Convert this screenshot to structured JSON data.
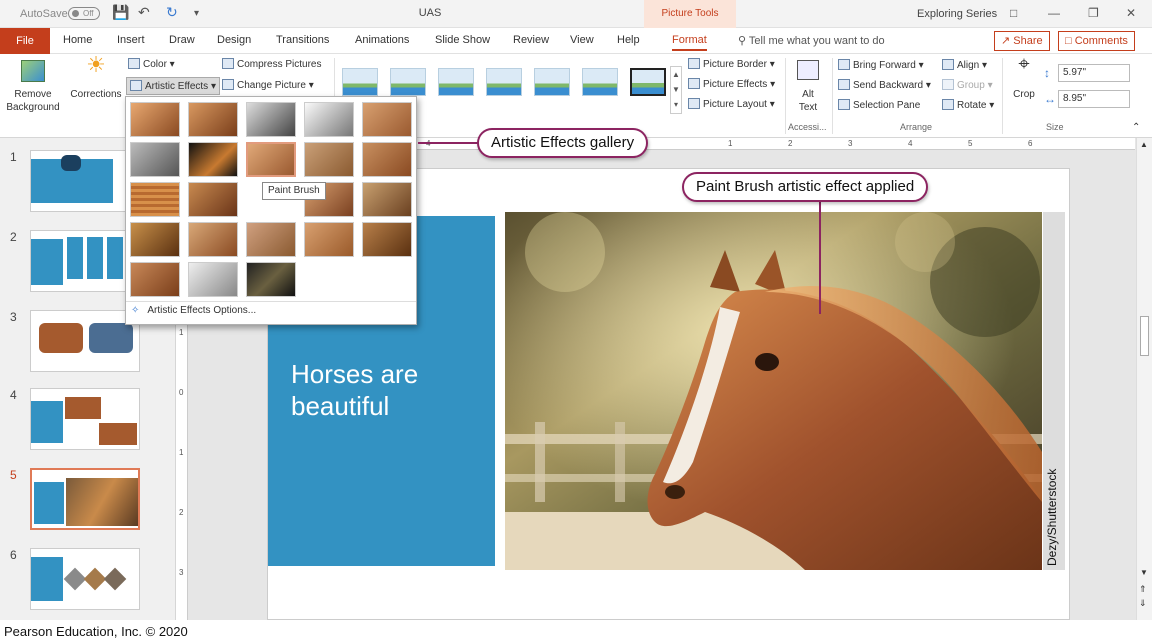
{
  "titlebar": {
    "autosave": "AutoSave",
    "autosave_state": "Off",
    "doc_title": "UAS",
    "context_tab": "Picture Tools",
    "series": "Exploring Series"
  },
  "tabs": {
    "file": "File",
    "items": [
      "Home",
      "Insert",
      "Draw",
      "Design",
      "Transitions",
      "Animations",
      "Slide Show",
      "Review",
      "View",
      "Help",
      "Format"
    ],
    "tell_me": "Tell me what you want to do",
    "share": "Share",
    "comments": "Comments"
  },
  "ribbon": {
    "remove_background": "Remove Background",
    "corrections": "Corrections",
    "color": "Color",
    "artistic_effects": "Artistic Effects",
    "compress": "Compress Pictures",
    "change": "Change Picture",
    "picture_border": "Picture Border",
    "picture_effects": "Picture Effects",
    "picture_layout": "Picture Layout",
    "alt_text": "Alt Text",
    "accessibility": "Accessi...",
    "bring_forward": "Bring Forward",
    "send_backward": "Send Backward",
    "selection_pane": "Selection Pane",
    "align": "Align",
    "group": "Group",
    "rotate": "Rotate",
    "arrange": "Arrange",
    "crop": "Crop",
    "height": "5.97\"",
    "width": "8.95\"",
    "size": "Size"
  },
  "gallery": {
    "tooltip": "Paint Brush",
    "options": "Artistic Effects Options..."
  },
  "slides": {
    "numbers": [
      "1",
      "2",
      "3",
      "4",
      "5",
      "6"
    ],
    "active_index": 5
  },
  "slide": {
    "title": "Horses are beautiful",
    "credit": "Dezy/Shutterstock"
  },
  "callouts": {
    "gallery": "Artistic Effects gallery",
    "paint_brush": "Paint Brush artistic effect applied"
  },
  "ruler": {
    "h": [
      "4",
      "1",
      "2",
      "3",
      "4",
      "5",
      "6"
    ],
    "v": [
      "1",
      "0",
      "1",
      "2",
      "3"
    ]
  },
  "footer": "Pearson Education, Inc. © 2020",
  "colors": {
    "accent": "#c43e1c",
    "slide_blue": "#3392c2",
    "callout_border": "#8c2461"
  }
}
